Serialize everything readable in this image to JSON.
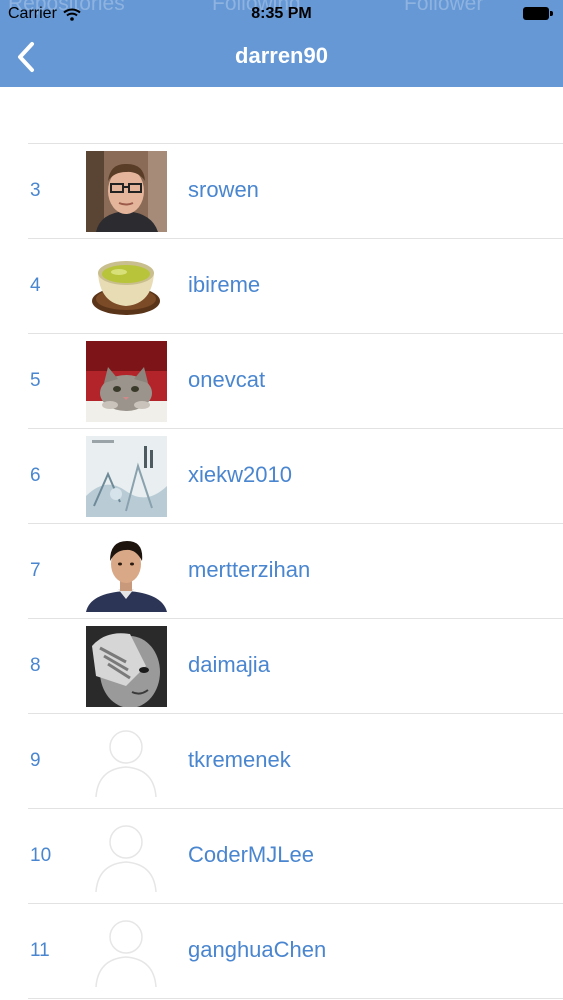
{
  "status_bar": {
    "carrier": "Carrier",
    "time": "8:35 PM"
  },
  "background_tabs": [
    "Repositories",
    "Following",
    "Follower"
  ],
  "nav": {
    "title": "darren90",
    "back_icon": "chevron-left-icon"
  },
  "colors": {
    "nav_bg": "#6598d4",
    "link": "#4a86cf",
    "divider": "#e2e2e2"
  },
  "users": [
    {
      "rank": "3",
      "login": "srowen",
      "avatar": "portrait-glasses"
    },
    {
      "rank": "4",
      "login": "ibireme",
      "avatar": "tea-cup"
    },
    {
      "rank": "5",
      "login": "onevcat",
      "avatar": "cat"
    },
    {
      "rank": "6",
      "login": "xiekw2010",
      "avatar": "album-cover"
    },
    {
      "rank": "7",
      "login": "mertterzihan",
      "avatar": "portrait"
    },
    {
      "rank": "8",
      "login": "daimajia",
      "avatar": "face-hand-bw"
    },
    {
      "rank": "9",
      "login": "tkremenek",
      "avatar": "placeholder-person"
    },
    {
      "rank": "10",
      "login": "CoderMJLee",
      "avatar": "placeholder-person"
    },
    {
      "rank": "11",
      "login": "ganghuaChen",
      "avatar": "placeholder-person"
    }
  ]
}
